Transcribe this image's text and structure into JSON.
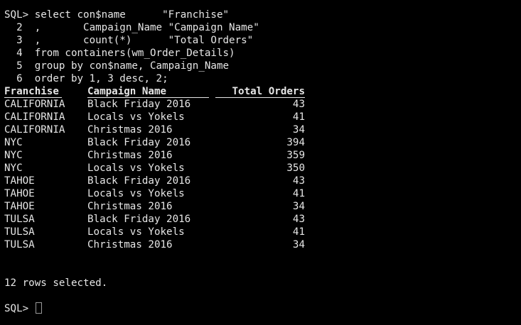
{
  "query": {
    "lines": [
      "SQL> select con$name      \"Franchise\"",
      "  2  ,       Campaign_Name \"Campaign Name\"",
      "  3  ,       count(*)      \"Total Orders\"",
      "  4  from containers(wm_Order_Details)",
      "  5  group by con$name, Campaign_Name",
      "  6  order by 1, 3 desc, 2;"
    ]
  },
  "table": {
    "headers": [
      "Franchise",
      "Campaign Name",
      "Total Orders"
    ],
    "rows": [
      [
        "CALIFORNIA",
        "Black Friday 2016",
        "43"
      ],
      [
        "CALIFORNIA",
        "Locals vs Yokels",
        "41"
      ],
      [
        "CALIFORNIA",
        "Christmas 2016",
        "34"
      ],
      [
        "NYC",
        "Black Friday 2016",
        "394"
      ],
      [
        "NYC",
        "Christmas 2016",
        "359"
      ],
      [
        "NYC",
        "Locals vs Yokels",
        "350"
      ],
      [
        "TAHOE",
        "Black Friday 2016",
        "43"
      ],
      [
        "TAHOE",
        "Locals vs Yokels",
        "41"
      ],
      [
        "TAHOE",
        "Christmas 2016",
        "34"
      ],
      [
        "TULSA",
        "Black Friday 2016",
        "43"
      ],
      [
        "TULSA",
        "Locals vs Yokels",
        "41"
      ],
      [
        "TULSA",
        "Christmas 2016",
        "34"
      ]
    ]
  },
  "footer": {
    "rows_selected": "12 rows selected.",
    "prompt": "SQL> "
  },
  "colors": {
    "background": "#000000",
    "text": "#e6e6e6",
    "cursor_outline": "#9a9a9a"
  }
}
